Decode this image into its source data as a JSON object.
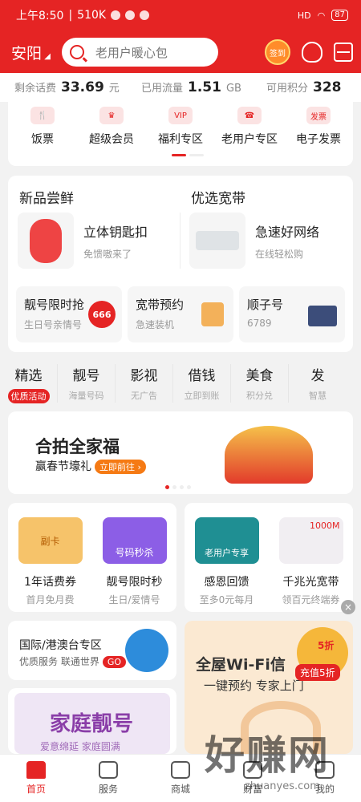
{
  "status": {
    "time": "上午8:50",
    "speed": "510K",
    "battery": "87",
    "signal": "HD"
  },
  "header": {
    "city": "安阳",
    "search_placeholder": "老用户暖心包",
    "signin": "签到"
  },
  "stats": [
    {
      "label": "剩余话费",
      "value": "33.69",
      "unit": "元"
    },
    {
      "label": "已用流量",
      "value": "1.51",
      "unit": "GB"
    },
    {
      "label": "可用积分",
      "value": "328",
      "unit": ""
    }
  ],
  "quick": [
    {
      "label": "饭票",
      "icon": "fork-knife-icon",
      "glyph": "🍴"
    },
    {
      "label": "超级会员",
      "icon": "crown-icon",
      "glyph": "♛"
    },
    {
      "label": "福利专区",
      "icon": "vip-bag-icon",
      "glyph": "VIP"
    },
    {
      "label": "老用户专区",
      "icon": "phone-icon",
      "glyph": "☎"
    },
    {
      "label": "电子发票",
      "icon": "invoice-icon",
      "glyph": "发票"
    }
  ],
  "new_section": {
    "title": "新品尝鲜",
    "item": {
      "name": "立体钥匙扣",
      "sub": "免馈嗷来了"
    }
  },
  "broadband_section": {
    "title": "优选宽带",
    "item": {
      "name": "急速好网络",
      "sub": "在线轻松购"
    }
  },
  "small_cards": [
    {
      "title": "靓号限时抢",
      "sub": "生日号亲情号",
      "badge": "666"
    },
    {
      "title": "宽带预约",
      "sub": "急速装机"
    },
    {
      "title": "顺子号",
      "sub": "6789"
    }
  ],
  "tabs": [
    {
      "label": "精选",
      "sub": "优质活动"
    },
    {
      "label": "靓号",
      "sub": "海量号码"
    },
    {
      "label": "影视",
      "sub": "无广告"
    },
    {
      "label": "借钱",
      "sub": "立即到账"
    },
    {
      "label": "美食",
      "sub": "积分兑"
    },
    {
      "label": "发",
      "sub": "智慧"
    }
  ],
  "banner": {
    "title": "合拍全家福",
    "sub": "赢春节壕礼",
    "cta": "立即前往 ›"
  },
  "promos": [
    {
      "title": "1年话费券",
      "sub": "首月免月费",
      "img": "副卡"
    },
    {
      "title": "靓号限时秒",
      "sub": "生日/爱情号",
      "img": "号码秒杀"
    },
    {
      "title": "感恩回馈",
      "sub": "至多0元每月",
      "img": "老用户专享"
    },
    {
      "title": "千兆光宽带",
      "sub": "领百元终端券",
      "img": "1000M"
    }
  ],
  "intl": {
    "title": "国际/港澳台专区",
    "sub": "优质服务 联通世界",
    "go": "GO"
  },
  "family": {
    "title": "家庭靓号",
    "sub": "爱意绵延 家庭圆满"
  },
  "wifi": {
    "title": "全屋Wi-Fi信",
    "sub": "一键预约 专家上门",
    "coupon": "充值5折",
    "coupon_top": "5折"
  },
  "close": "×",
  "nav": [
    {
      "label": "首页",
      "icon": "home-icon"
    },
    {
      "label": "服务",
      "icon": "grid-icon"
    },
    {
      "label": "商城",
      "icon": "bag-icon"
    },
    {
      "label": "财富",
      "icon": "wallet-icon"
    },
    {
      "label": "我的",
      "icon": "user-icon"
    }
  ],
  "watermark": {
    "main": "好赚网",
    "url": "zhuanyes.com"
  }
}
